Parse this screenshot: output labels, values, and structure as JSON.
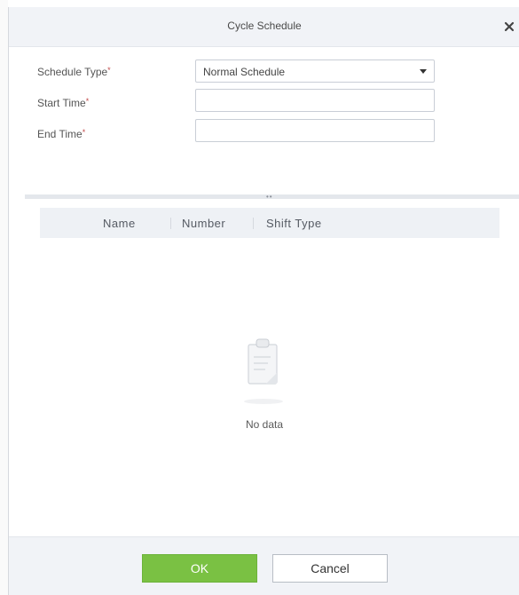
{
  "dialog": {
    "title": "Cycle Schedule"
  },
  "form": {
    "schedule_type": {
      "label": "Schedule Type",
      "required_mark": "*",
      "value": "Normal Schedule"
    },
    "start_time": {
      "label": "Start Time",
      "required_mark": "*",
      "value": ""
    },
    "end_time": {
      "label": "End Time",
      "required_mark": "*",
      "value": ""
    }
  },
  "grid": {
    "columns": [
      "Name",
      "Number",
      "Shift Type"
    ],
    "empty_text": "No data"
  },
  "footer": {
    "ok_label": "OK",
    "cancel_label": "Cancel"
  },
  "colors": {
    "ok_button": "#7ac143",
    "header_bg": "#f1f3f7",
    "required_mark": "#c24a4a"
  },
  "icons": {
    "close": "close-icon",
    "dropdown": "chevron-down-icon",
    "empty": "clipboard-icon"
  }
}
